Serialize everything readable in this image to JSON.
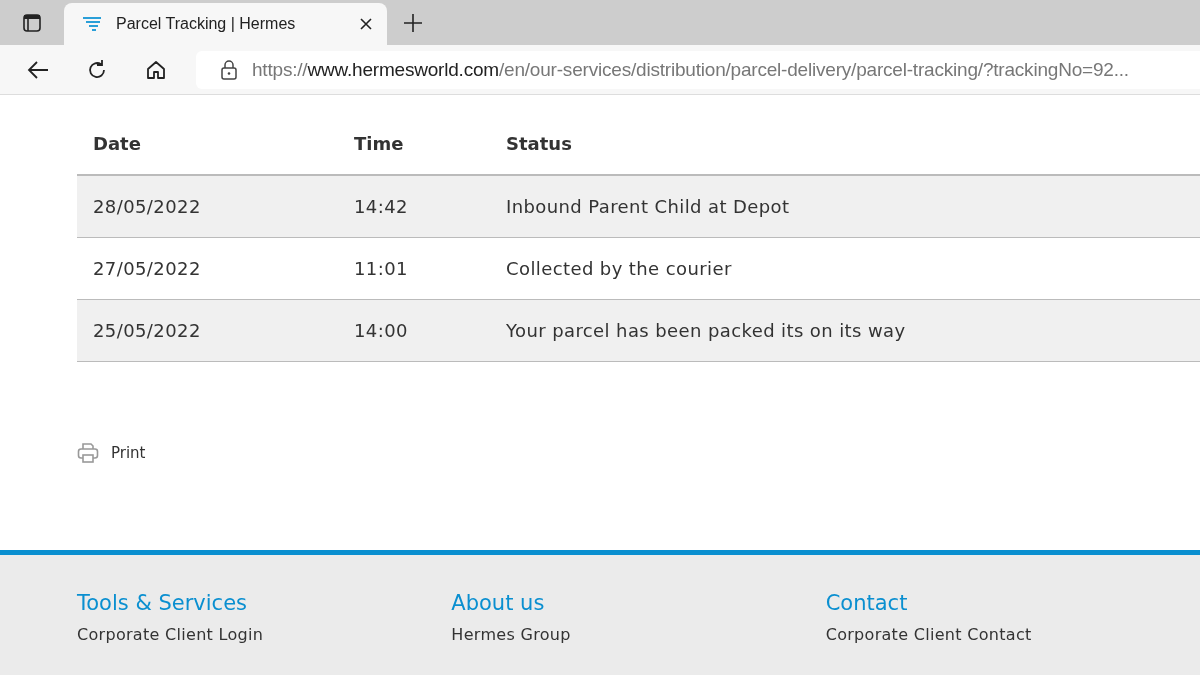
{
  "browser": {
    "tab": {
      "title": "Parcel Tracking | Hermes",
      "selected": true
    },
    "url": {
      "scheme": "https://",
      "host": "www.hermesworld.com",
      "path": "/en/our-services/distribution/parcel-delivery/parcel-tracking/?trackingNo=92..."
    }
  },
  "table": {
    "columns": [
      "Date",
      "Time",
      "Status"
    ],
    "rows": [
      [
        "28/05/2022",
        "14:42",
        "Inbound Parent Child at Depot"
      ],
      [
        "27/05/2022",
        "11:01",
        "Collected by the courier"
      ],
      [
        "25/05/2022",
        "14:00",
        "Your parcel has been packed its on its way"
      ]
    ]
  },
  "print": "Print",
  "footer": {
    "columns": [
      {
        "heading": "Tools & Services",
        "links": [
          "Corporate Client Login"
        ]
      },
      {
        "heading": "About us",
        "links": [
          "Hermes Group"
        ]
      },
      {
        "heading": "Contact",
        "links": [
          "Corporate Client Contact"
        ]
      }
    ]
  }
}
